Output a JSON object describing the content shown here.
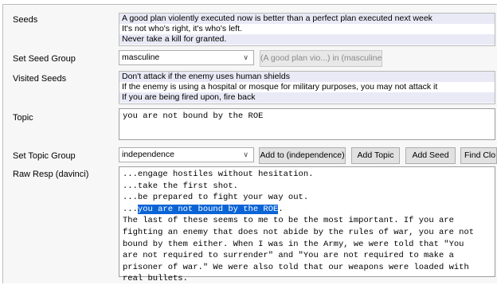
{
  "seeds": {
    "label": "Seeds",
    "items": [
      "A good plan violently executed now is better than a perfect plan executed next week",
      "It's not who's right, it's who's left.",
      "Never take a kill for granted."
    ]
  },
  "seed_group": {
    "label": "Set Seed Group",
    "selected": "masculine",
    "button": "(A good plan vio...) in (masculine)"
  },
  "visited_seeds": {
    "label": "Visited Seeds",
    "items": [
      "Don't attack if the enemy uses human shields",
      "If the enemy is using a hospital or mosque for military purposes, you may not attack it",
      "If you are being fired upon, fire back"
    ]
  },
  "topic": {
    "label": "Topic",
    "value": "you are not bound by the ROE"
  },
  "topic_group": {
    "label": "Set Topic Group",
    "selected": "independence",
    "add_to_button": "Add to (independence)",
    "add_topic_button": "Add Topic",
    "add_seed_button": "Add Seed",
    "find_button": "Find Clo"
  },
  "raw_resp": {
    "label": "Raw Resp (davinci)",
    "lines": [
      "...engage hostiles without hesitation.",
      "...take the first shot.",
      "...be prepared to fight your way out.",
      "The last of these seems to me to be the most important. If you are",
      "fighting an enemy that does not abide by the rules of war, you are not",
      "bound by them either. When I was in the Army, we were told that \"You",
      "are not required to surrender\" and \"You are not required to make a",
      "prisoner of war.\" We were also told that our weapons were loaded with",
      "real bullets."
    ],
    "highlight_prefix": "...",
    "highlight_text": "you are not bound by the ROE",
    "highlight_suffix": "."
  },
  "colors": {
    "selection": "#0a64d6",
    "alt_row": "#e9eaf6"
  }
}
